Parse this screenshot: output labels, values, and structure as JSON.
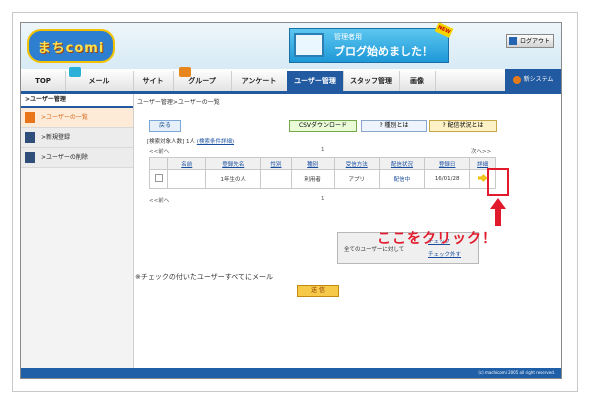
{
  "header": {
    "logo_text": "まちcomi",
    "banner_sub": "管理者用",
    "banner_main": "ブログ始めました！",
    "banner_badge": "NEW",
    "logout_label": "ログアウト"
  },
  "nav": {
    "tabs": [
      {
        "label": "TOP"
      },
      {
        "label": "メール"
      },
      {
        "label": "サイト"
      },
      {
        "label": "グループ"
      },
      {
        "label": "アンケート"
      },
      {
        "label": "ユーザー管理",
        "active": true
      },
      {
        "label": "スタッフ管理"
      },
      {
        "label": "画像"
      }
    ],
    "system_label": "新システム",
    "accent_color": "#215aa0"
  },
  "sidebar": {
    "title": ">ユーザー管理",
    "items": [
      {
        "label": ">ユーザーの一覧",
        "active": true
      },
      {
        "label": ">新規登録"
      },
      {
        "label": ">ユーザーの削除"
      }
    ]
  },
  "main": {
    "breadcrumb": "ユーザー管理>ユーザーの一覧",
    "back_label": "戻る",
    "csv_label": "CSVダウンロード",
    "kind_label": "? 種別とは",
    "status_label": "? 配信状況とは",
    "search_text": "[検索対象人数] 1人",
    "search_link": "(検索条件詳細)",
    "prev": "<<前へ",
    "next": "次へ>>",
    "page": "1",
    "table": {
      "headers": [
        "",
        "名前",
        "登録先名",
        "性別",
        "種別",
        "受信方法",
        "配信状況",
        "登録日",
        "詳細"
      ],
      "rows": [
        [
          "",
          "",
          "1年生の人",
          "",
          "利用者",
          "アプリ",
          "配信中",
          "16/01/28",
          ""
        ]
      ]
    },
    "all_users_label": "全てのユーザーに対して",
    "check_link_1": "チェック",
    "check_link_2": "チェック外す",
    "callout": "ここをクリック！",
    "mail_note": "※チェックの付いたユーザーすべてにメール",
    "send_label": "送 信",
    "footer": "(c) machicomi 2005 all right reserved."
  }
}
